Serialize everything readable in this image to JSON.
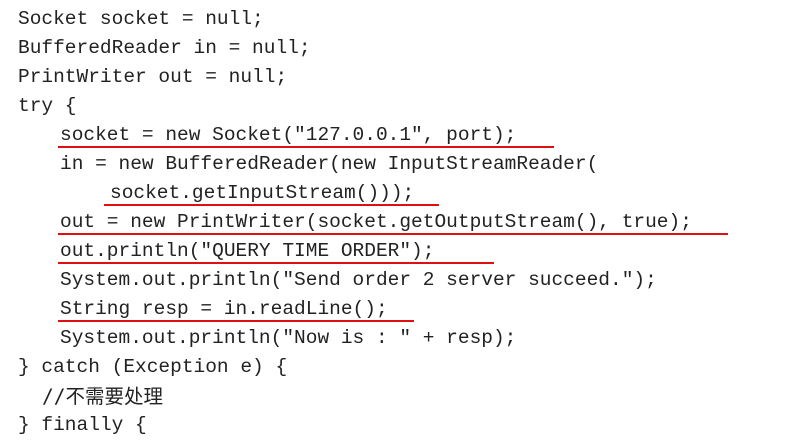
{
  "code": {
    "lines": [
      "Socket socket = null;",
      "BufferedReader in = null;",
      "PrintWriter out = null;",
      "try {",
      "socket = new Socket(\"127.0.0.1\", port);",
      "in = new BufferedReader(new InputStreamReader(",
      "socket.getInputStream()));",
      "out = new PrintWriter(socket.getOutputStream(), true);",
      "out.println(\"QUERY TIME ORDER\");",
      "System.out.println(\"Send order 2 server succeed.\");",
      "String resp = in.readLine();",
      "System.out.println(\"Now is : \" + resp);",
      "} catch (Exception e) {",
      "//不需要处理",
      "} finally {"
    ]
  },
  "annotations": {
    "underline_color": "#e01010"
  }
}
